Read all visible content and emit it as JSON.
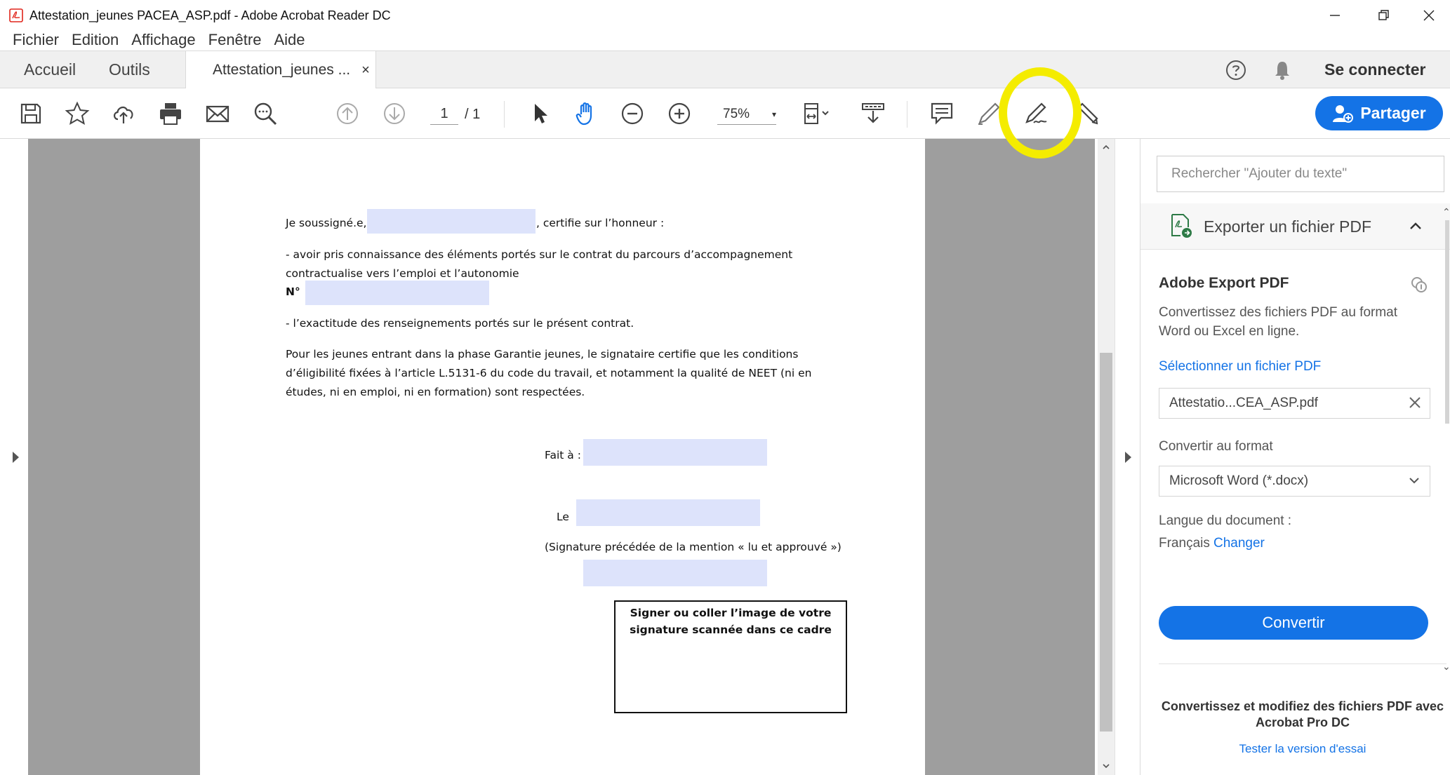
{
  "window": {
    "title": "Attestation_jeunes PACEA_ASP.pdf - Adobe Acrobat Reader DC"
  },
  "menu": [
    "Fichier",
    "Edition",
    "Affichage",
    "Fenêtre",
    "Aide"
  ],
  "tabs": {
    "home": "Accueil",
    "tools": "Outils",
    "document": "Attestation_jeunes ...",
    "close_glyph": "×",
    "sign_in": "Se connecter"
  },
  "toolbar": {
    "page_current": "1",
    "page_total": "/ 1",
    "zoom": "75%",
    "zoom_caret": "▾",
    "share_label": "Partager",
    "icons": [
      "save-icon",
      "bookmark-star-icon",
      "cloud-upload-icon",
      "print-icon",
      "email-icon",
      "search-zoom-icon",
      "page-up-icon",
      "page-down-icon",
      "select-arrow-icon",
      "hand-icon",
      "zoom-out-icon",
      "zoom-in-icon",
      "fit-page-icon",
      "scroll-mode-icon",
      "comment-icon",
      "highlight-pen-icon",
      "sign-icon",
      "fill-sign-icon"
    ]
  },
  "document": {
    "line1_start": "Je soussigné.e,",
    "line1_end": ", certifie sur l’honneur :",
    "line2": "- avoir pris connaissance des éléments portés sur le contrat du parcours d’accompagnement",
    "line3": "contractualise vers l’emploi et l’autonomie",
    "line4": "N°",
    "line5": "- l’exactitude des renseignements portés sur le présent contrat.",
    "line6": "Pour les jeunes entrant dans la phase Garantie jeunes, le signataire certifie que les conditions",
    "line7": "d’éligibilité fixées à l’article L.5131-6 du code du travail, et notamment la qualité de NEET (ni en",
    "line8": "études, ni en emploi, ni en formation) sont respectées.",
    "fait_a": "Fait à :",
    "le": "Le",
    "signature_mention": "(Signature précédée de la mention « lu et approuvé »)",
    "signature_box": "Signer ou coller l’image de votre\nsignature scannée dans ce cadre"
  },
  "right_panel": {
    "search_placeholder": "Rechercher \"Ajouter du texte\"",
    "export_header": "Exporter un fichier PDF",
    "title": "Adobe Export PDF",
    "description": "Convertissez des fichiers PDF au format Word ou Excel en ligne.",
    "select_file_link": "Sélectionner un fichier PDF",
    "file_name": "Attestatio...CEA_ASP.pdf",
    "convert_to_label": "Convertir au format",
    "format_value": "Microsoft Word (*.docx)",
    "language_label": "Langue du document :",
    "language_value": "Français",
    "change_link": "Changer",
    "convert_button": "Convertir",
    "promo": "Convertissez et modifiez des fichiers PDF avec Acrobat Pro DC",
    "trial_link": "Tester la version d'essai"
  },
  "colors": {
    "accent": "#1473e6",
    "highlight": "#f4ec00",
    "form_field": "#dde3fb",
    "canvas_gray": "#9e9e9e"
  }
}
